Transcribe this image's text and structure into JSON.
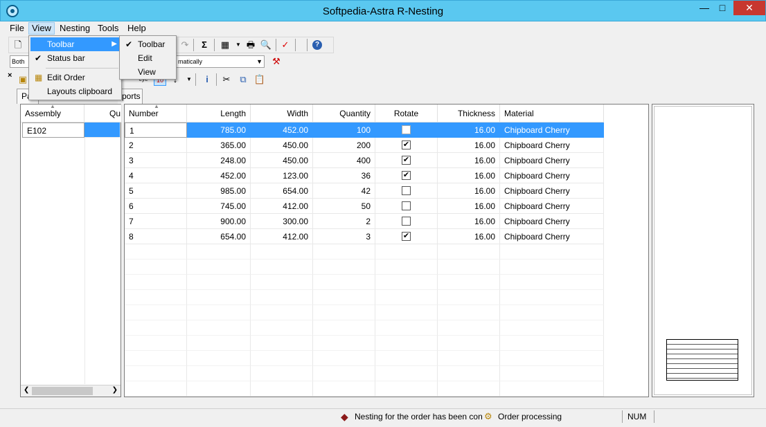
{
  "window": {
    "title": "Softpedia-Astra R-Nesting",
    "min": "—",
    "max": "□",
    "close": "✕"
  },
  "menubar": [
    "File",
    "View",
    "Nesting",
    "Tools",
    "Help"
  ],
  "view_menu": {
    "items": [
      {
        "label": "Toolbar",
        "has_submenu": true,
        "highlighted": true
      },
      {
        "label": "Status bar",
        "checked": true
      },
      {
        "label": "Edit Order",
        "icon": "grid-icon"
      },
      {
        "label": "Layouts clipboard"
      }
    ]
  },
  "toolbar_submenu": {
    "items": [
      {
        "label": "Toolbar",
        "checked": true
      },
      {
        "label": "Edit"
      },
      {
        "label": "View"
      }
    ]
  },
  "toolbar2": {
    "mode_combo": "Both",
    "method_combo": "matically"
  },
  "tabs": [
    "Pa",
    "ports"
  ],
  "assembly_grid": {
    "headers": [
      "Assembly",
      "Qu"
    ],
    "rows": [
      [
        "E102",
        ""
      ]
    ]
  },
  "parts_grid": {
    "headers": [
      "Number",
      "Length",
      "Width",
      "Quantity",
      "Rotate",
      "Thickness",
      "Material"
    ],
    "rows": [
      [
        "1",
        "785.00",
        "452.00",
        "100",
        false,
        "16.00",
        "Chipboard Cherry"
      ],
      [
        "2",
        "365.00",
        "450.00",
        "200",
        true,
        "16.00",
        "Chipboard Cherry"
      ],
      [
        "3",
        "248.00",
        "450.00",
        "400",
        true,
        "16.00",
        "Chipboard Cherry"
      ],
      [
        "4",
        "452.00",
        "123.00",
        "36",
        true,
        "16.00",
        "Chipboard Cherry"
      ],
      [
        "5",
        "985.00",
        "654.00",
        "42",
        false,
        "16.00",
        "Chipboard Cherry"
      ],
      [
        "6",
        "745.00",
        "412.00",
        "50",
        false,
        "16.00",
        "Chipboard Cherry"
      ],
      [
        "7",
        "900.00",
        "300.00",
        "2",
        false,
        "16.00",
        "Chipboard Cherry"
      ],
      [
        "8",
        "654.00",
        "412.00",
        "3",
        true,
        "16.00",
        "Chipboard Cherry"
      ]
    ]
  },
  "statusbar": {
    "message": "Nesting for the order has been con",
    "process": "Order processing",
    "mode": "NUM"
  }
}
